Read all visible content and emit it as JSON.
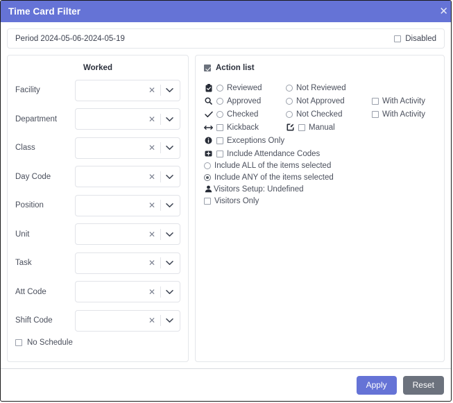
{
  "window": {
    "title": "Time Card Filter",
    "close_icon": "close-icon"
  },
  "period": {
    "label": "Period 2024-05-06-2024-05-19",
    "disabled_label": "Disabled",
    "disabled_checked": false
  },
  "worked_panel": {
    "title": "Worked",
    "fields": [
      {
        "label": "Facility",
        "value": "",
        "clear_icon": "clear-icon",
        "chevron_icon": "chevron-down-icon"
      },
      {
        "label": "Department",
        "value": "",
        "clear_icon": "clear-icon",
        "chevron_icon": "chevron-down-icon"
      },
      {
        "label": "Class",
        "value": "",
        "clear_icon": "clear-icon",
        "chevron_icon": "chevron-down-icon"
      },
      {
        "label": "Day Code",
        "value": "",
        "clear_icon": "clear-icon",
        "chevron_icon": "chevron-down-icon"
      },
      {
        "label": "Position",
        "value": "",
        "clear_icon": "clear-icon",
        "chevron_icon": "chevron-down-icon"
      },
      {
        "label": "Unit",
        "value": "",
        "clear_icon": "clear-icon",
        "chevron_icon": "chevron-down-icon"
      },
      {
        "label": "Task",
        "value": "",
        "clear_icon": "clear-icon",
        "chevron_icon": "chevron-down-icon"
      },
      {
        "label": "Att Code",
        "value": "",
        "clear_icon": "clear-icon",
        "chevron_icon": "chevron-down-icon"
      },
      {
        "label": "Shift Code",
        "value": "",
        "clear_icon": "clear-icon",
        "chevron_icon": "chevron-down-icon"
      }
    ],
    "no_schedule_label": "No Schedule",
    "no_schedule_checked": false
  },
  "action_panel": {
    "header_label": "Action list",
    "header_checked": true,
    "rows": [
      {
        "icon": "clipboard-check-icon",
        "col1": {
          "label": "Reviewed",
          "control": "radio",
          "selected": false
        },
        "col2": {
          "label": "Not Reviewed",
          "control": "radio",
          "selected": false
        },
        "col3": null
      },
      {
        "icon": "magnifier-icon",
        "col1": {
          "label": "Approved",
          "control": "radio",
          "selected": false
        },
        "col2": {
          "label": "Not Approved",
          "control": "radio",
          "selected": false
        },
        "col3": {
          "label": "With Activity",
          "control": "checkbox",
          "checked": false
        }
      },
      {
        "icon": "check-icon",
        "col1": {
          "label": "Checked",
          "control": "radio",
          "selected": false
        },
        "col2": {
          "label": "Not Checked",
          "control": "radio",
          "selected": false
        },
        "col3": {
          "label": "With Activity",
          "control": "checkbox",
          "checked": false
        }
      },
      {
        "icon": "left-right-arrow-icon",
        "col1": {
          "label": "Kickback",
          "control": "checkbox",
          "checked": false
        },
        "col2": {
          "label": "Manual",
          "control": "checkbox",
          "checked": false,
          "icon": "edit-square-icon"
        },
        "col3": null
      },
      {
        "icon": "info-icon",
        "col1": {
          "label": "Exceptions Only",
          "control": "checkbox",
          "checked": false
        },
        "col2": null,
        "col3": null
      },
      {
        "icon": "add-square-icon",
        "col1": {
          "label": "Include Attendance Codes",
          "control": "checkbox",
          "checked": false
        },
        "col2": null,
        "col3": null
      }
    ],
    "include_all": {
      "label": "Include ALL of the items selected",
      "control": "radio",
      "selected": false
    },
    "include_any": {
      "label": "Include ANY of the items selected",
      "control": "radio",
      "selected": true
    },
    "visitors_setup": {
      "label": "Visitors Setup: Undefined",
      "icon": "person-icon"
    },
    "visitors_only": {
      "label": "Visitors Only",
      "control": "checkbox",
      "checked": false
    }
  },
  "footer": {
    "apply_label": "Apply",
    "reset_label": "Reset",
    "apply_color": "#6573d6",
    "reset_color": "#6c727d"
  }
}
